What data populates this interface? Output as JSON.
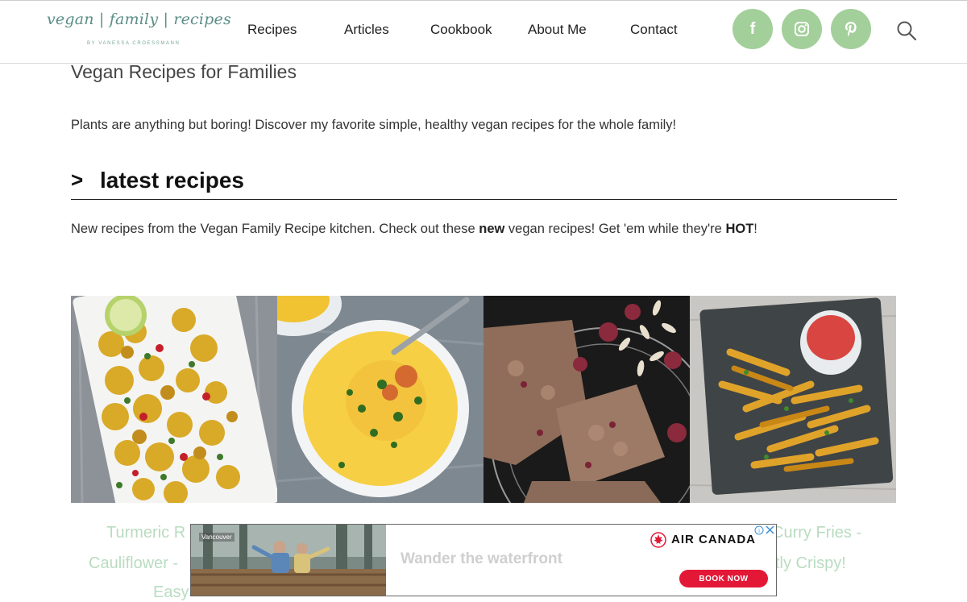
{
  "brand": {
    "logo_text": "vegan | family | recipes",
    "logo_sub": "BY VANESSA CROESSMANN"
  },
  "nav": [
    {
      "label": "Recipes"
    },
    {
      "label": "Articles"
    },
    {
      "label": "Cookbook"
    },
    {
      "label": "About Me"
    },
    {
      "label": "Contact"
    }
  ],
  "social": [
    {
      "icon": "facebook-icon",
      "glyph": "f"
    },
    {
      "icon": "instagram-icon"
    },
    {
      "icon": "pinterest-icon"
    }
  ],
  "colors": {
    "accent": "#a3cf9a",
    "caption": "#b9dcc0",
    "ad_button": "#e31837"
  },
  "page": {
    "heading": "Vegan Recipes for Families",
    "intro": "Plants are anything but boring! Discover my favorite simple, healthy vegan recipes for the whole family!"
  },
  "section": {
    "chevron": ">",
    "title": "latest recipes",
    "desc_part1": "New recipes from the Vegan Family Recipe kitchen. Check out these ",
    "desc_bold1": "new",
    "desc_part2": " vegan recipes! Get 'em while they're ",
    "desc_bold2": "HOT",
    "desc_part3": "!"
  },
  "recipes": [
    {
      "caption_lines": [
        "Turmeric R",
        "Cauliflower -",
        "Easy"
      ]
    },
    {
      "caption_lines": []
    },
    {
      "caption_lines": []
    },
    {
      "caption_lines": [
        "Curry Fries -",
        "tly Crispy!"
      ]
    }
  ],
  "ad": {
    "photo_label": "Vancouver",
    "headline": "Wander the waterfront",
    "brand": "AIR CANADA",
    "button": "BOOK NOW"
  }
}
